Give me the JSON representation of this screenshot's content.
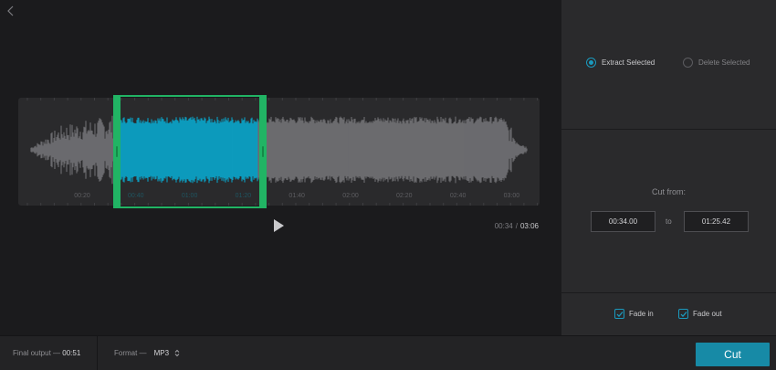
{
  "colors": {
    "accent": "#178aa6",
    "selection_wave": "#0d9bbd",
    "unselected_wave": "#6b6b6e",
    "selection_border": "#21b464"
  },
  "header": {
    "back_icon": "chevron-left-icon"
  },
  "waveform": {
    "time_labels": [
      "00:20",
      "00:40",
      "01:00",
      "01:20",
      "01:40",
      "02:00",
      "02:20",
      "02:40",
      "03:00"
    ],
    "selection_start_fraction": 0.183,
    "selection_end_fraction": 0.459
  },
  "playback": {
    "play_icon": "play-icon",
    "current_time": "00:34",
    "separator": "/",
    "total_time": "03:06"
  },
  "mode": {
    "options": [
      {
        "label": "Extract Selected",
        "selected": true
      },
      {
        "label": "Delete Selected",
        "selected": false
      }
    ]
  },
  "cut_range": {
    "label": "Cut from:",
    "start": "00:34.00",
    "to_label": "to",
    "end": "01:25.42"
  },
  "fades": {
    "fade_in": {
      "label": "Fade in",
      "checked": true
    },
    "fade_out": {
      "label": "Fade out",
      "checked": true
    }
  },
  "footer": {
    "final_output_label": "Final output —",
    "final_output_value": "00:51",
    "format_label": "Format —",
    "format_value": "MP3",
    "cut_button": "Cut"
  }
}
